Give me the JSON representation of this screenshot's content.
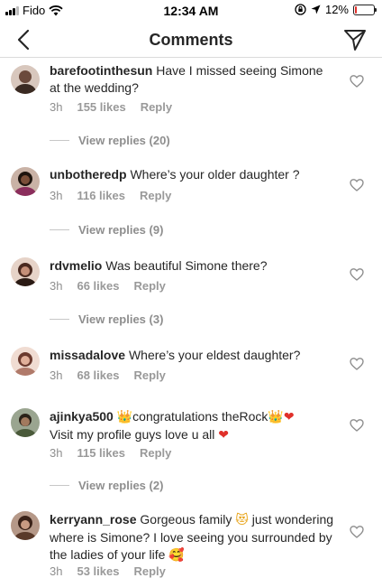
{
  "status_bar": {
    "carrier": "Fido",
    "time": "12:34 AM",
    "battery": "12%",
    "battery_level": 0.12
  },
  "nav": {
    "title": "Comments"
  },
  "comments": [
    {
      "username": "barefootinthesun",
      "text": "Have I missed seeing Simone at the wedding?",
      "time": "3h",
      "likes": "155 likes",
      "reply": "Reply",
      "view_replies": "View replies (20)",
      "avatar_color": "#6b4a3c"
    },
    {
      "username": "unbotheredp",
      "text": "Where’s your older daughter ?",
      "time": "3h",
      "likes": "116 likes",
      "reply": "Reply",
      "view_replies": "View replies (9)",
      "avatar_color": "#3a2418"
    },
    {
      "username": "rdvmelio",
      "text": "Was beautiful Simone there?",
      "time": "3h",
      "likes": "66 likes",
      "reply": "Reply",
      "view_replies": "View replies (3)",
      "avatar_color": "#8a5a4a"
    },
    {
      "username": "missadalove",
      "text": "Where’s your eldest daughter?",
      "time": "3h",
      "likes": "68 likes",
      "reply": "Reply",
      "avatar_color": "#b07a6a"
    },
    {
      "username": "ajinkya500",
      "text_parts": [
        "congratulations theRock",
        "Visit my profile guys love u all"
      ],
      "emoji_crown": "👑",
      "emoji_heart": "❤",
      "time": "3h",
      "likes": "115 likes",
      "reply": "Reply",
      "view_replies": "View replies (2)",
      "avatar_color": "#4a5a3a"
    },
    {
      "username": "kerryann_rose",
      "text_parts": [
        "Gorgeous family",
        "just wondering where is Simone? I love seeing you surrounded by the ladies of your life"
      ],
      "emoji_cat": "😻",
      "emoji_love": "🥰",
      "time": "3h",
      "likes": "53 likes",
      "reply": "Reply",
      "avatar_color": "#5a3a2a"
    }
  ],
  "icons": {
    "back": "chevron-left-icon",
    "send": "direct-send-icon",
    "like": "heart-outline-icon",
    "wifi": "wifi-icon",
    "location": "location-arrow-icon",
    "lock": "orientation-lock-icon"
  },
  "colors": {
    "text": "#262626",
    "secondary": "#8e8e8e",
    "battery_low": "#e0302a"
  }
}
